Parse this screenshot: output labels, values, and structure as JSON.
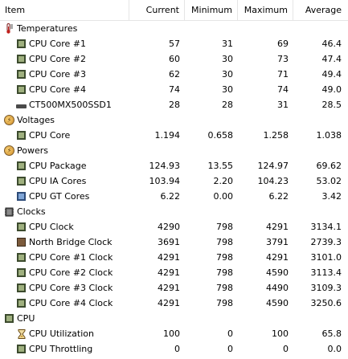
{
  "header": {
    "item": "Item",
    "current": "Current",
    "minimum": "Minimum",
    "maximum": "Maximum",
    "average": "Average"
  },
  "rows": [
    {
      "type": "group",
      "icon": "thermometer-icon",
      "label": "Temperatures"
    },
    {
      "type": "sensor",
      "icon": "cpu-chip-icon",
      "label": "CPU Core #1",
      "current": "57",
      "minimum": "31",
      "maximum": "69",
      "average": "46.4"
    },
    {
      "type": "sensor",
      "icon": "cpu-chip-icon",
      "label": "CPU Core #2",
      "current": "60",
      "minimum": "30",
      "maximum": "73",
      "average": "47.4"
    },
    {
      "type": "sensor",
      "icon": "cpu-chip-icon",
      "label": "CPU Core #3",
      "current": "62",
      "minimum": "30",
      "maximum": "71",
      "average": "49.4"
    },
    {
      "type": "sensor",
      "icon": "cpu-chip-icon",
      "label": "CPU Core #4",
      "current": "74",
      "minimum": "30",
      "maximum": "74",
      "average": "49.0"
    },
    {
      "type": "sensor",
      "icon": "ssd-drive-icon",
      "label": "CT500MX500SSD1",
      "current": "28",
      "minimum": "28",
      "maximum": "31",
      "average": "28.5"
    },
    {
      "type": "group",
      "icon": "voltage-icon",
      "label": "Voltages"
    },
    {
      "type": "sensor",
      "icon": "cpu-chip-icon",
      "label": "CPU Core",
      "current": "1.194",
      "minimum": "0.658",
      "maximum": "1.258",
      "average": "1.038"
    },
    {
      "type": "group",
      "icon": "power-icon",
      "label": "Powers"
    },
    {
      "type": "sensor",
      "icon": "cpu-chip-icon",
      "label": "CPU Package",
      "current": "124.93",
      "minimum": "13.55",
      "maximum": "124.97",
      "average": "69.62"
    },
    {
      "type": "sensor",
      "icon": "cpu-chip-icon",
      "label": "CPU IA Cores",
      "current": "103.94",
      "minimum": "2.20",
      "maximum": "104.23",
      "average": "53.02"
    },
    {
      "type": "sensor",
      "icon": "gpu-chip-icon",
      "label": "CPU GT Cores",
      "current": "6.22",
      "minimum": "0.00",
      "maximum": "6.22",
      "average": "3.42"
    },
    {
      "type": "group",
      "icon": "clock-icon",
      "label": "Clocks"
    },
    {
      "type": "sensor",
      "icon": "cpu-chip-icon",
      "label": "CPU Clock",
      "current": "4290",
      "minimum": "798",
      "maximum": "4291",
      "average": "3134.1"
    },
    {
      "type": "sensor",
      "icon": "north-bridge-icon",
      "label": "North Bridge Clock",
      "current": "3691",
      "minimum": "798",
      "maximum": "3791",
      "average": "2739.3"
    },
    {
      "type": "sensor",
      "icon": "cpu-chip-icon",
      "label": "CPU Core #1 Clock",
      "current": "4291",
      "minimum": "798",
      "maximum": "4291",
      "average": "3101.0"
    },
    {
      "type": "sensor",
      "icon": "cpu-chip-icon",
      "label": "CPU Core #2 Clock",
      "current": "4291",
      "minimum": "798",
      "maximum": "4590",
      "average": "3113.4"
    },
    {
      "type": "sensor",
      "icon": "cpu-chip-icon",
      "label": "CPU Core #3 Clock",
      "current": "4291",
      "minimum": "798",
      "maximum": "4490",
      "average": "3109.3"
    },
    {
      "type": "sensor",
      "icon": "cpu-chip-icon",
      "label": "CPU Core #4 Clock",
      "current": "4291",
      "minimum": "798",
      "maximum": "4590",
      "average": "3250.6"
    },
    {
      "type": "group",
      "icon": "cpu-chip-icon",
      "label": "CPU"
    },
    {
      "type": "sensor",
      "icon": "hourglass-icon",
      "label": "CPU Utilization",
      "current": "100",
      "minimum": "0",
      "maximum": "100",
      "average": "65.8"
    },
    {
      "type": "sensor",
      "icon": "cpu-chip-icon",
      "label": "CPU Throttling",
      "current": "0",
      "minimum": "0",
      "maximum": "0",
      "average": "0.0"
    }
  ]
}
